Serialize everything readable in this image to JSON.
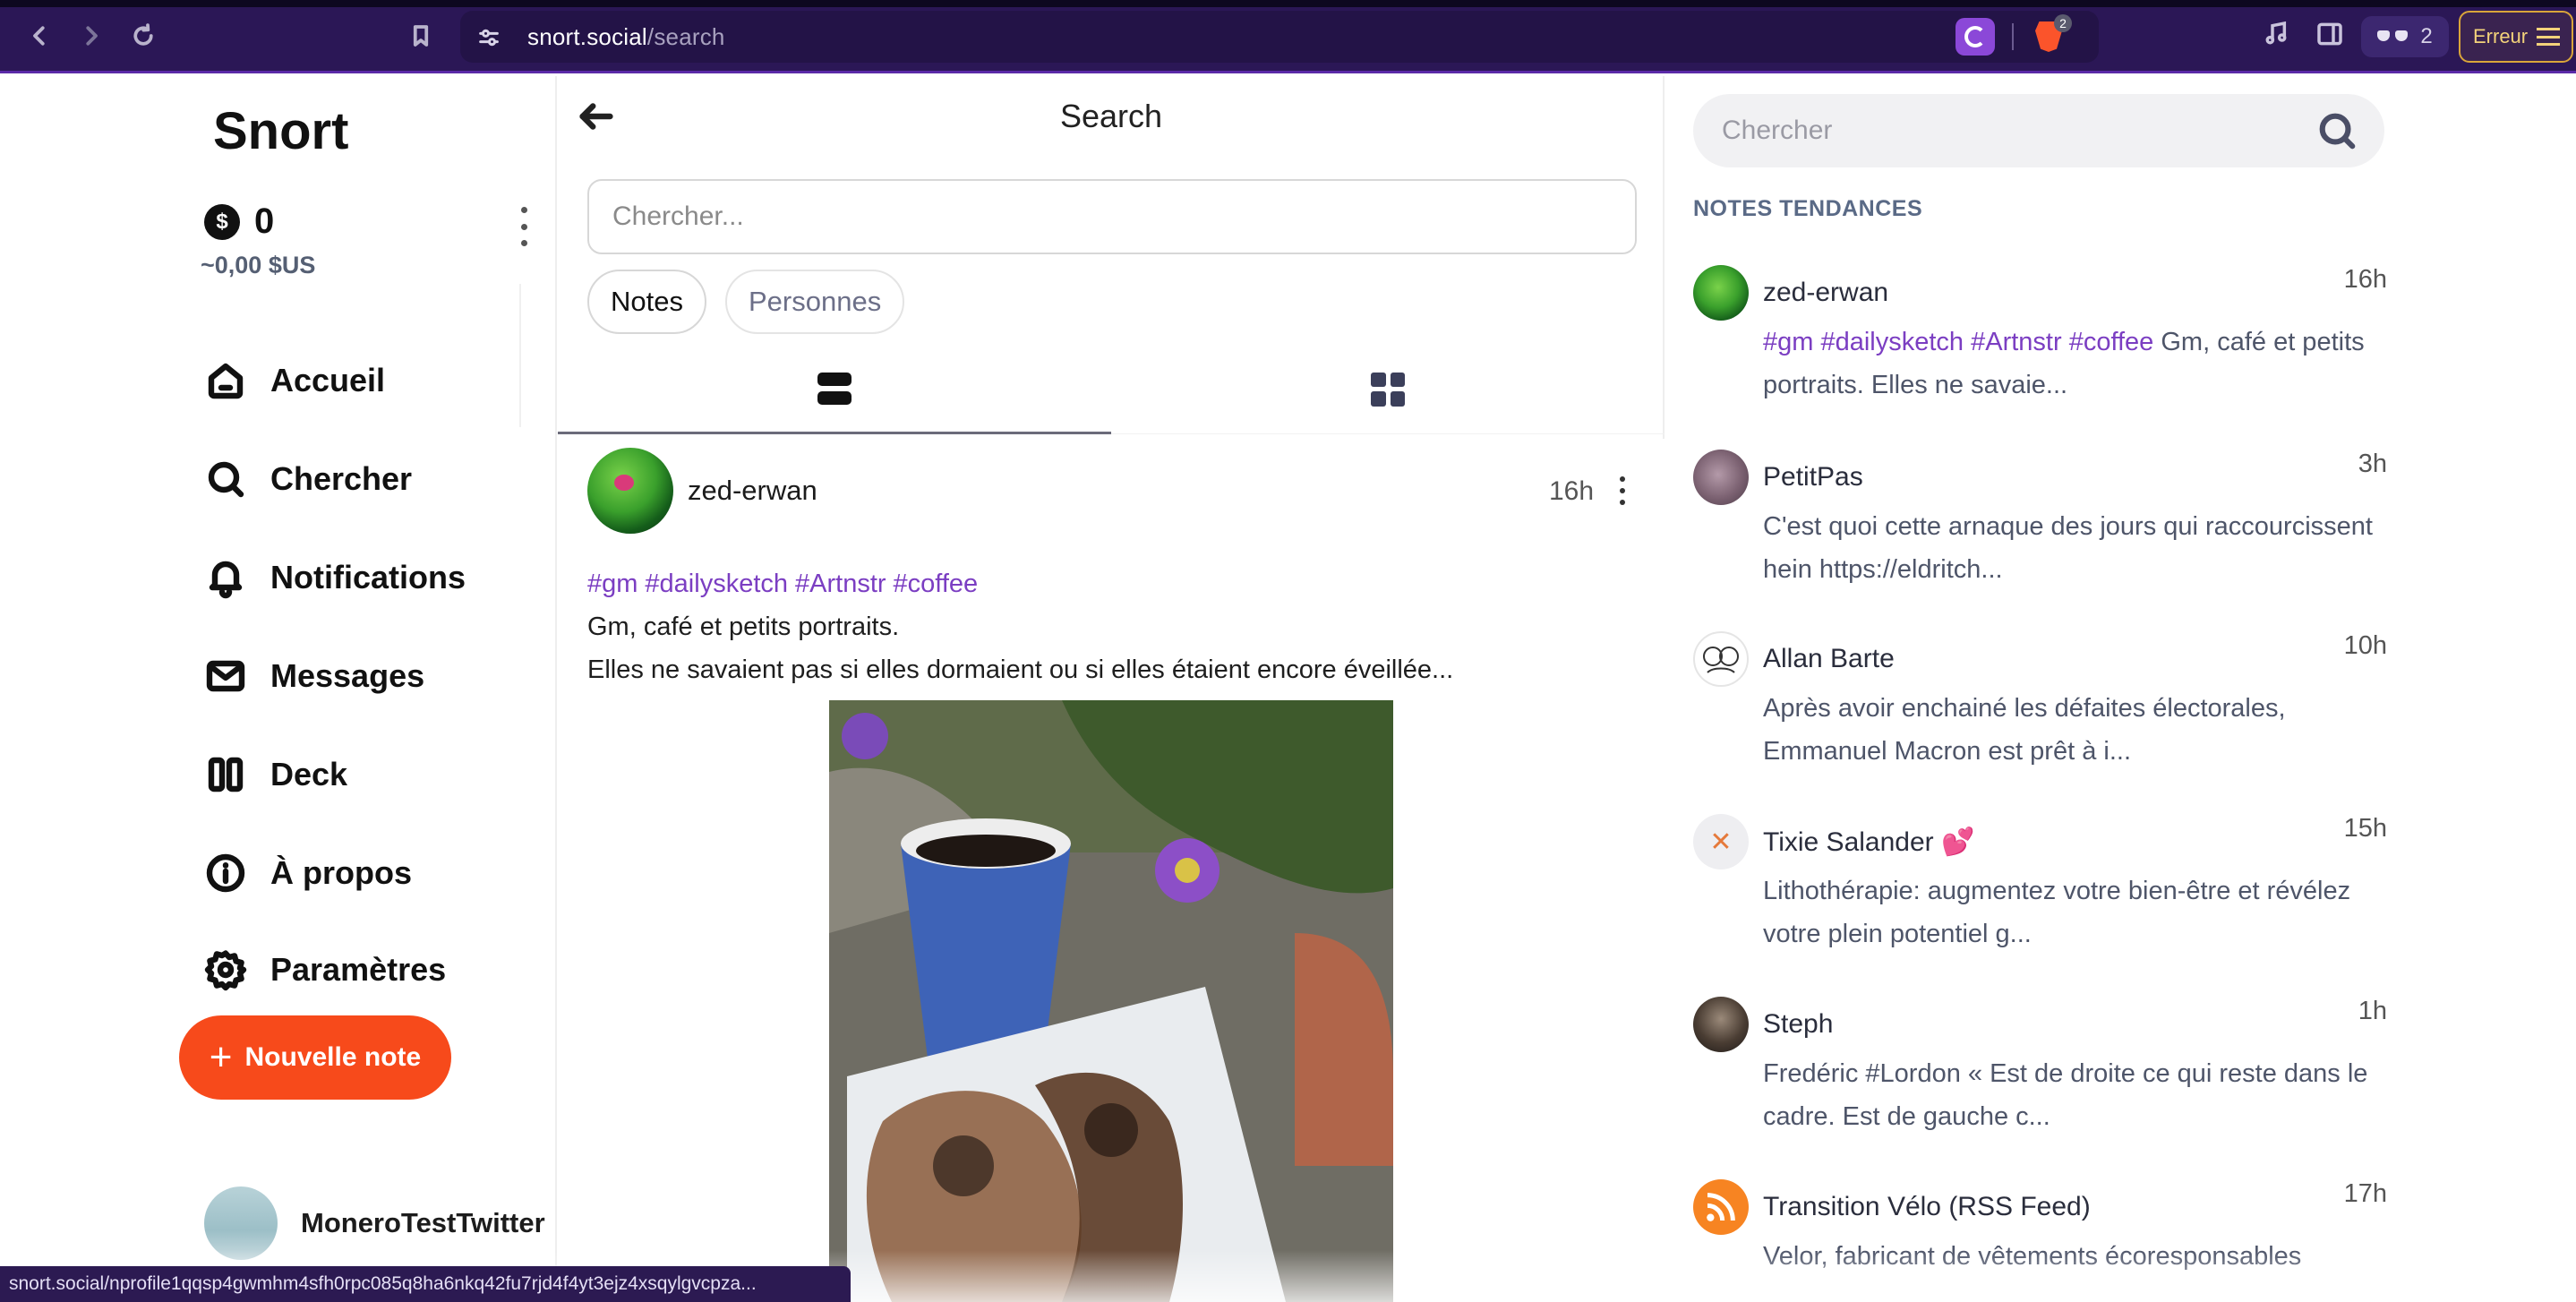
{
  "browser": {
    "url_host": "snort.social",
    "url_path": "/search",
    "extension_badge": "2",
    "vpn_count": "2",
    "error_label": "Erreur"
  },
  "sidebar": {
    "logo": "Snort",
    "balance": "0",
    "fiat_balance": "~0,00 $US",
    "items": [
      {
        "label": "Accueil",
        "icon": "home-icon"
      },
      {
        "label": "Chercher",
        "icon": "search-icon"
      },
      {
        "label": "Notifications",
        "icon": "bell-icon"
      },
      {
        "label": "Messages",
        "icon": "mail-icon"
      },
      {
        "label": "Deck",
        "icon": "columns-icon"
      },
      {
        "label": "À propos",
        "icon": "info-icon"
      },
      {
        "label": "Paramètres",
        "icon": "gear-icon"
      }
    ],
    "new_note_label": "Nouvelle note",
    "profile_name": "MoneroTestTwitter"
  },
  "search": {
    "title": "Search",
    "placeholder": "Chercher...",
    "filters": [
      "Notes",
      "Personnes"
    ]
  },
  "post": {
    "author": "zed-erwan",
    "time": "16h",
    "hashtags": [
      "#gm",
      "#dailysketch",
      "#Artnstr",
      "#coffee"
    ],
    "line1": "Gm, café et petits portraits.",
    "line2": "Elles ne savaient pas si elles dormaient ou si elles étaient encore éveillée..."
  },
  "trending": {
    "search_placeholder": "Chercher",
    "header": "NOTES TENDANCES",
    "notes": [
      {
        "name": "zed-erwan",
        "time": "16h",
        "tags": "#gm #dailysketch #Artnstr #coffee",
        "text": " Gm, café et petits portraits. Elles ne savaie..."
      },
      {
        "name": "PetitPas",
        "time": "3h",
        "tags": "",
        "text": "C'est quoi cette arnaque des jours qui raccourcissent hein https://eldritch..."
      },
      {
        "name": "Allan Barte",
        "time": "10h",
        "tags": "",
        "text": "Après avoir enchainé les défaites électorales, Emmanuel Macron est prêt à i..."
      },
      {
        "name": "Tixie Salander 💕",
        "time": "15h",
        "tags": "",
        "text": "Lithothérapie: augmentez votre bien-être et révélez votre plein potentiel g..."
      },
      {
        "name": "Steph",
        "time": "1h",
        "tags": "",
        "text": "Fredéric #Lordon « Est de droite ce qui reste dans le cadre. Est de gauche c..."
      },
      {
        "name": "Transition Vélo (RSS Feed)",
        "time": "17h",
        "tags": "",
        "text": "Velor, fabricant de vêtements écoresponsables"
      }
    ]
  },
  "status_url": "snort.social/nprofile1qqsp4gwmhm4sfh0rpc085q8ha6nkq42fu7rjd4f4yt3ejz4xsqylgvcpza..."
}
